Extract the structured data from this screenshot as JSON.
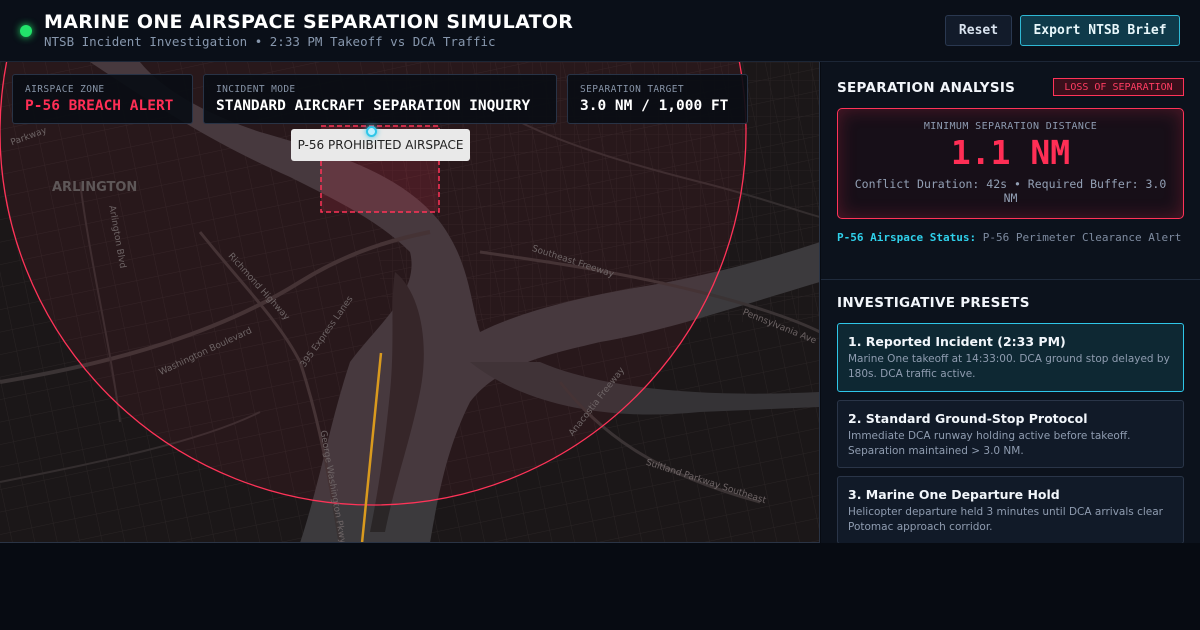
{
  "header": {
    "title": "MARINE ONE AIRSPACE SEPARATION SIMULATOR",
    "subtitle": "NTSB Incident Investigation • 2:33 PM Takeoff vs DCA Traffic",
    "reset_label": "Reset",
    "export_label": "Export NTSB Brief",
    "status_color": "#22e36a"
  },
  "map": {
    "area_label": "ARLINGTON",
    "street_labels": [
      "Arlington Blvd",
      "Richmond Highway",
      "Washington Boulevard",
      "395 Express Lanes",
      "Southeast Freeway",
      "Anacostia Freeway",
      "Suitland Parkway Southeast",
      "Pennsylvania Ave",
      "George Washington Pkwy",
      "Parkway"
    ],
    "cards": [
      {
        "key": "AIRSPACE ZONE",
        "value": "P-56 BREACH ALERT"
      },
      {
        "key": "INCIDENT MODE",
        "value": "STANDARD AIRCRAFT SEPARATION INQUIRY"
      },
      {
        "key": "SEPARATION TARGET",
        "value": "3.0 NM / 1,000 FT"
      }
    ],
    "tooltip": "P-56 PROHIBITED AIRSPACE",
    "alert_color": "#ff3358",
    "flight_path_color": "#d99a1e"
  },
  "panel": {
    "analysis_title": "SEPARATION ANALYSIS",
    "badge": "LOSS OF SEPARATION",
    "min_sep_label": "MINIMUM SEPARATION DISTANCE",
    "min_sep_value": "1.1 NM",
    "conflict_text": "Conflict Duration: 42s • Required Buffer: 3.0 NM",
    "status_lead": "P-56 Airspace Status:",
    "status_text": "P-56 Perimeter Clearance Alert",
    "presets_title": "INVESTIGATIVE PRESETS",
    "presets": [
      {
        "title": "1. Reported Incident (2:33 PM)",
        "desc": "Marine One takeoff at 14:33:00. DCA ground stop delayed by 180s. DCA traffic active."
      },
      {
        "title": "2. Standard Ground-Stop Protocol",
        "desc": "Immediate DCA runway holding active before takeoff. Separation maintained > 3.0 NM."
      },
      {
        "title": "3. Marine One Departure Hold",
        "desc": "Helicopter departure held 3 minutes until DCA arrivals clear Potomac approach corridor."
      }
    ]
  }
}
